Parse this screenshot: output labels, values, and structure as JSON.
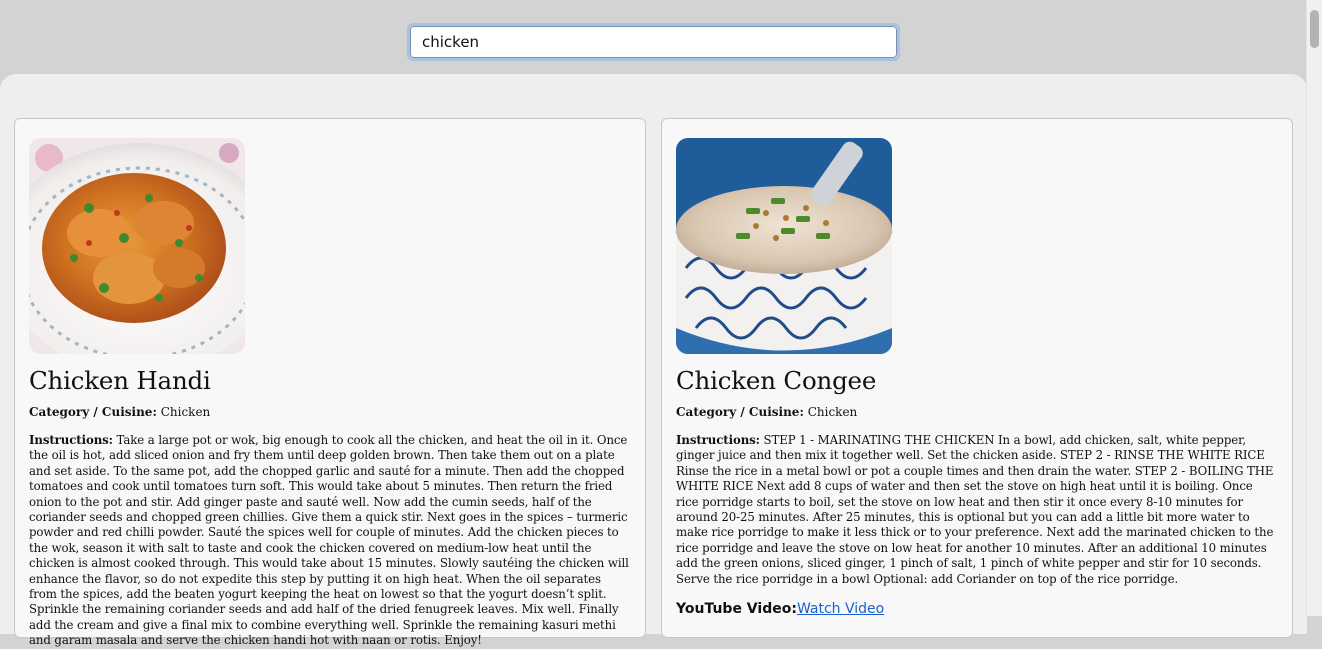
{
  "search": {
    "value": "chicken",
    "placeholder": ""
  },
  "recipes": [
    {
      "title": "Chicken Handi",
      "category_label": "Category / Cuisine:",
      "category": "Chicken",
      "instructions_label": "Instructions:",
      "instructions": "Take a large pot or wok, big enough to cook all the chicken, and heat the oil in it. Once the oil is hot, add sliced onion and fry them until deep golden brown. Then take them out on a plate and set aside. To the same pot, add the chopped garlic and sauté for a minute. Then add the chopped tomatoes and cook until tomatoes turn soft. This would take about 5 minutes. Then return the fried onion to the pot and stir. Add ginger paste and sauté well. Now add the cumin seeds, half of the coriander seeds and chopped green chillies. Give them a quick stir. Next goes in the spices – turmeric powder and red chilli powder. Sauté the spices well for couple of minutes. Add the chicken pieces to the wok, season it with salt to taste and cook the chicken covered on medium-low heat until the chicken is almost cooked through. This would take about 15 minutes. Slowly sautéing the chicken will enhance the flavor, so do not expedite this step by putting it on high heat. When the oil separates from the spices, add the beaten yogurt keeping the heat on lowest so that the yogurt doesn’t split. Sprinkle the remaining coriander seeds and add half of the dried fenugreek leaves. Mix well. Finally add the cream and give a final mix to combine everything well. Sprinkle the remaining kasuri methi and garam masala and serve the chicken handi hot with naan or rotis. Enjoy!"
    },
    {
      "title": "Chicken Congee",
      "category_label": "Category / Cuisine:",
      "category": "Chicken",
      "instructions_label": "Instructions:",
      "instructions": "STEP 1 - MARINATING THE CHICKEN In a bowl, add chicken, salt, white pepper, ginger juice and then mix it together well. Set the chicken aside. STEP 2 - RINSE THE WHITE RICE Rinse the rice in a metal bowl or pot a couple times and then drain the water. STEP 2 - BOILING THE WHITE RICE Next add 8 cups of water and then set the stove on high heat until it is boiling. Once rice porridge starts to boil, set the stove on low heat and then stir it once every 8-10 minutes for around 20-25 minutes. After 25 minutes, this is optional but you can add a little bit more water to make rice porridge to make it less thick or to your preference. Next add the marinated chicken to the rice porridge and leave the stove on low heat for another 10 minutes. After an additional 10 minutes add the green onions, sliced ginger, 1 pinch of salt, 1 pinch of white pepper and stir for 10 seconds. Serve the rice porridge in a bowl Optional: add Coriander on top of the rice porridge.",
      "video_label": "YouTube Video:",
      "video_link": "Watch Video"
    }
  ],
  "colors": {
    "page_bg": "#d3d3d3",
    "panel_bg": "#eeeeee",
    "card_bg": "#f8f8f8",
    "link": "#1a5fd0",
    "focus_ring": "#a9c1e2"
  }
}
